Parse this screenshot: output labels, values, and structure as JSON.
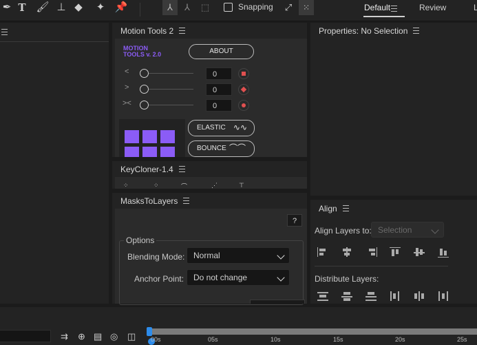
{
  "toolbar": {
    "snapping_label": "Snapping",
    "workspace_default": "Default",
    "workspace_review": "Review",
    "workspace_more": "L"
  },
  "motion_tools": {
    "panel_title": "Motion Tools 2",
    "logo_line1": "MOTION",
    "logo_line2": "TOOLS v. 2.0",
    "about_label": "ABOUT",
    "rows": [
      {
        "symbol": "<",
        "value": "0"
      },
      {
        "symbol": ">",
        "value": "0"
      },
      {
        "symbol": "><",
        "value": "0"
      }
    ],
    "elastic_label": "ELASTIC",
    "bounce_label": "BOUNCE"
  },
  "keycloner": {
    "panel_title": "KeyCloner-1.4"
  },
  "masks": {
    "panel_title": "MasksToLayers",
    "help_label": "?",
    "options_legend": "Options",
    "blending_label": "Blending Mode:",
    "blending_value": "Normal",
    "anchor_label": "Anchor Point:",
    "anchor_value": "Do not change"
  },
  "properties": {
    "panel_title": "Properties: No Selection"
  },
  "align": {
    "panel_title": "Align",
    "align_to_label": "Align Layers to:",
    "align_to_value": "Selection",
    "distribute_label": "Distribute Layers:"
  },
  "timeline": {
    "ticks": [
      "00s",
      "05s",
      "10s",
      "15s",
      "20s",
      "25s"
    ]
  },
  "colors": {
    "accent_purple": "#8b5cf6",
    "keyframe_red": "#e05050",
    "playhead_blue": "#2d8ceb"
  }
}
